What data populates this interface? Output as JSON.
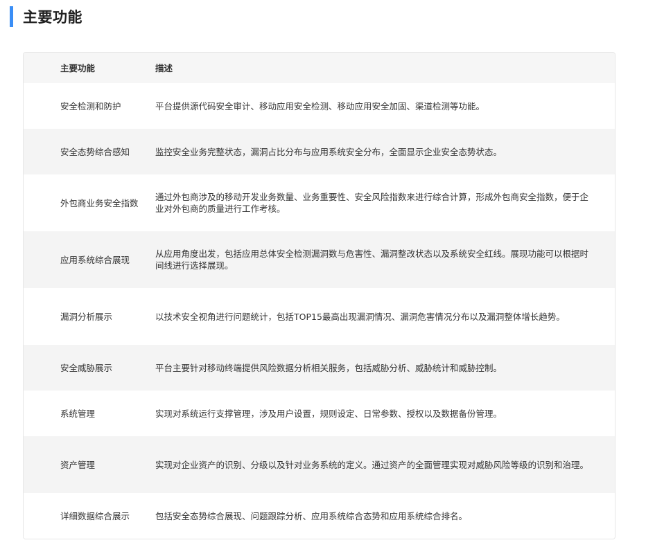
{
  "section": {
    "title": "主要功能",
    "accent_color": "#3a8ef6"
  },
  "table": {
    "headers": {
      "name": "主要功能",
      "desc": "描述"
    },
    "rows": [
      {
        "name": "安全检测和防护",
        "desc": "平台提供源代码安全审计、移动应用安全检测、移动应用安全加固、渠道检测等功能。"
      },
      {
        "name": "安全态势综合感知",
        "desc": "监控安全业务完整状态，漏洞占比分布与应用系统安全分布，全面显示企业安全态势状态。"
      },
      {
        "name": "外包商业务安全指数",
        "desc": "通过外包商涉及的移动开发业务数量、业务重要性、安全风险指数来进行综合计算，形成外包商安全指数，便于企业对外包商的质量进行工作考核。"
      },
      {
        "name": "应用系统综合展现",
        "desc": "从应用角度出发，包括应用总体安全检测漏洞数与危害性、漏洞整改状态以及系统安全红线。展现功能可以根据时间线进行选择展现。"
      },
      {
        "name": "漏洞分析展示",
        "desc": "以技术安全视角进行问题统计，包括TOP15最高出现漏洞情况、漏洞危害情况分布以及漏洞整体增长趋势。"
      },
      {
        "name": "安全威胁展示",
        "desc": "平台主要针对移动终端提供风险数据分析相关服务，包括威胁分析、威胁统计和威胁控制。"
      },
      {
        "name": "系统管理",
        "desc": "实现对系统运行支撑管理，涉及用户设置，规则设定、日常参数、授权以及数据备份管理。"
      },
      {
        "name": "资产管理",
        "desc": "实现对企业资产的识别、分级以及针对业务系统的定义。通过资产的全面管理实现对威胁风险等级的识别和治理。"
      },
      {
        "name": "详细数据综合展示",
        "desc": "包括安全态势综合展现、问题跟踪分析、应用系统综合态势和应用系统综合排名。"
      }
    ]
  }
}
